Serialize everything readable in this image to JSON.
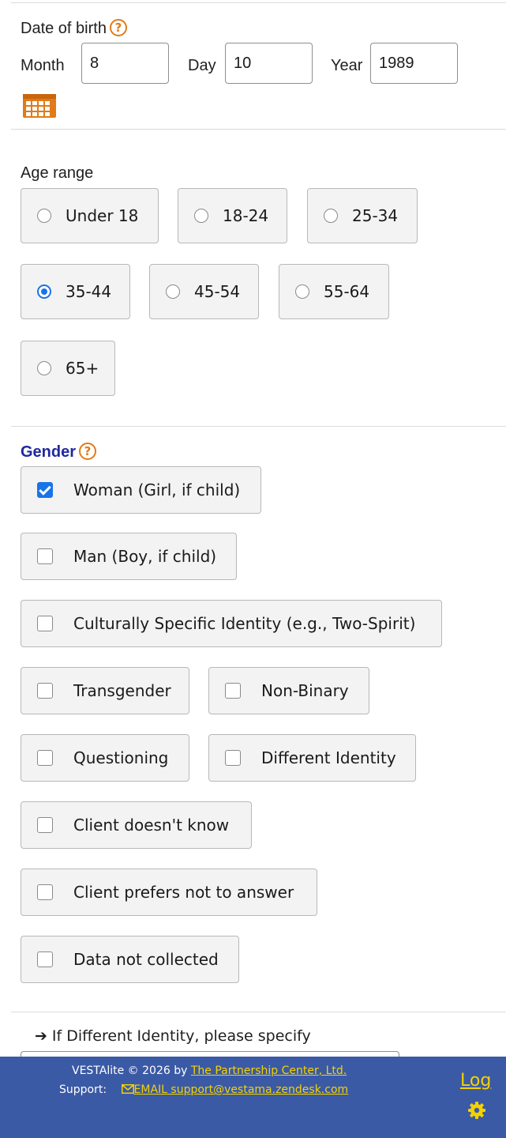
{
  "dob": {
    "label": "Date of birth",
    "help_icon": "?",
    "month_label": "Month",
    "month_value": "8",
    "day_label": "Day",
    "day_value": "10",
    "year_label": "Year",
    "year_value": "1989",
    "calendar_icon": "calendar-icon"
  },
  "age_range": {
    "label": "Age range",
    "options": [
      {
        "label": "Under 18",
        "selected": false
      },
      {
        "label": "18-24",
        "selected": false
      },
      {
        "label": "25-34",
        "selected": false
      },
      {
        "label": "35-44",
        "selected": true
      },
      {
        "label": "45-54",
        "selected": false
      },
      {
        "label": "55-64",
        "selected": false
      },
      {
        "label": "65+",
        "selected": false
      }
    ]
  },
  "gender": {
    "label": "Gender",
    "help_icon": "?",
    "options": [
      {
        "label": "Woman (Girl, if child)",
        "checked": true
      },
      {
        "label": "Man (Boy, if child)",
        "checked": false
      },
      {
        "label": "Culturally Specific Identity (e.g., Two-Spirit)",
        "checked": false
      },
      {
        "label": "Transgender",
        "checked": false
      },
      {
        "label": "Non-Binary",
        "checked": false
      },
      {
        "label": "Questioning",
        "checked": false
      },
      {
        "label": "Different Identity",
        "checked": false
      },
      {
        "label": "Client doesn't know",
        "checked": false
      },
      {
        "label": "Client prefers not to answer",
        "checked": false
      },
      {
        "label": "Data not collected",
        "checked": false
      }
    ]
  },
  "different_identity": {
    "arrow": "➔",
    "prompt": "If Different Identity, please specify"
  },
  "footer": {
    "copyright": "VESTAlite © 2026 by",
    "company_link": "The Partnership Center, Ltd.",
    "support_label": "Support:",
    "email_link": "EMAIL support@vestama.zendesk.com",
    "log_link": "Log",
    "gear_icon": "gear-icon"
  },
  "colors": {
    "accent": "#1a73e8",
    "help": "#e07b17",
    "footer_bg": "#3b5aa5",
    "footer_link": "#f4d200",
    "gender_title": "#1e2a9e"
  }
}
